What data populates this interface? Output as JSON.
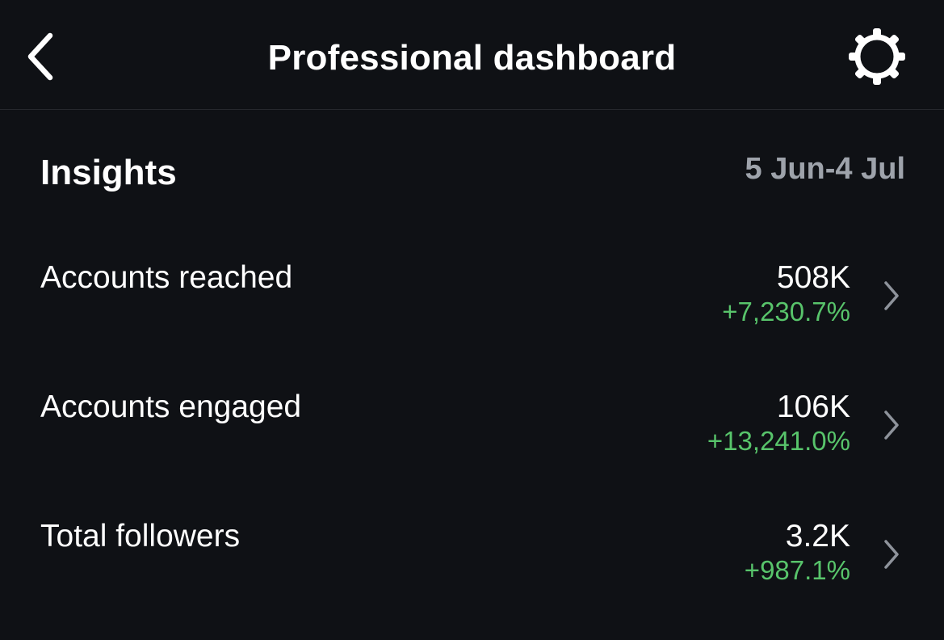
{
  "header": {
    "title": "Professional dashboard",
    "back_icon": "chevron-left-icon",
    "settings_icon": "gear-icon"
  },
  "insights": {
    "title": "Insights",
    "date_range": "5 Jun-4 Jul",
    "metrics": [
      {
        "label": "Accounts reached",
        "value": "508K",
        "change": "+7,230.7%"
      },
      {
        "label": "Accounts engaged",
        "value": "106K",
        "change": "+13,241.0%"
      },
      {
        "label": "Total followers",
        "value": "3.2K",
        "change": "+987.1%"
      }
    ]
  },
  "colors": {
    "background": "#0f1115",
    "text": "#ffffff",
    "muted": "#9ea3ab",
    "positive": "#58c46b"
  }
}
